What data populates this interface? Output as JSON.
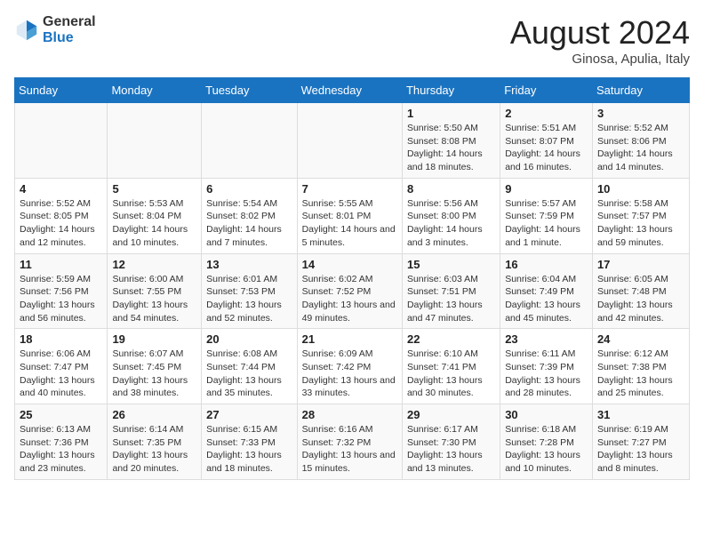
{
  "header": {
    "logo_general": "General",
    "logo_blue": "Blue",
    "main_title": "August 2024",
    "subtitle": "Ginosa, Apulia, Italy"
  },
  "weekdays": [
    "Sunday",
    "Monday",
    "Tuesday",
    "Wednesday",
    "Thursday",
    "Friday",
    "Saturday"
  ],
  "weeks": [
    [
      {
        "day": "",
        "info": ""
      },
      {
        "day": "",
        "info": ""
      },
      {
        "day": "",
        "info": ""
      },
      {
        "day": "",
        "info": ""
      },
      {
        "day": "1",
        "info": "Sunrise: 5:50 AM\nSunset: 8:08 PM\nDaylight: 14 hours and 18 minutes."
      },
      {
        "day": "2",
        "info": "Sunrise: 5:51 AM\nSunset: 8:07 PM\nDaylight: 14 hours and 16 minutes."
      },
      {
        "day": "3",
        "info": "Sunrise: 5:52 AM\nSunset: 8:06 PM\nDaylight: 14 hours and 14 minutes."
      }
    ],
    [
      {
        "day": "4",
        "info": "Sunrise: 5:52 AM\nSunset: 8:05 PM\nDaylight: 14 hours and 12 minutes."
      },
      {
        "day": "5",
        "info": "Sunrise: 5:53 AM\nSunset: 8:04 PM\nDaylight: 14 hours and 10 minutes."
      },
      {
        "day": "6",
        "info": "Sunrise: 5:54 AM\nSunset: 8:02 PM\nDaylight: 14 hours and 7 minutes."
      },
      {
        "day": "7",
        "info": "Sunrise: 5:55 AM\nSunset: 8:01 PM\nDaylight: 14 hours and 5 minutes."
      },
      {
        "day": "8",
        "info": "Sunrise: 5:56 AM\nSunset: 8:00 PM\nDaylight: 14 hours and 3 minutes."
      },
      {
        "day": "9",
        "info": "Sunrise: 5:57 AM\nSunset: 7:59 PM\nDaylight: 14 hours and 1 minute."
      },
      {
        "day": "10",
        "info": "Sunrise: 5:58 AM\nSunset: 7:57 PM\nDaylight: 13 hours and 59 minutes."
      }
    ],
    [
      {
        "day": "11",
        "info": "Sunrise: 5:59 AM\nSunset: 7:56 PM\nDaylight: 13 hours and 56 minutes."
      },
      {
        "day": "12",
        "info": "Sunrise: 6:00 AM\nSunset: 7:55 PM\nDaylight: 13 hours and 54 minutes."
      },
      {
        "day": "13",
        "info": "Sunrise: 6:01 AM\nSunset: 7:53 PM\nDaylight: 13 hours and 52 minutes."
      },
      {
        "day": "14",
        "info": "Sunrise: 6:02 AM\nSunset: 7:52 PM\nDaylight: 13 hours and 49 minutes."
      },
      {
        "day": "15",
        "info": "Sunrise: 6:03 AM\nSunset: 7:51 PM\nDaylight: 13 hours and 47 minutes."
      },
      {
        "day": "16",
        "info": "Sunrise: 6:04 AM\nSunset: 7:49 PM\nDaylight: 13 hours and 45 minutes."
      },
      {
        "day": "17",
        "info": "Sunrise: 6:05 AM\nSunset: 7:48 PM\nDaylight: 13 hours and 42 minutes."
      }
    ],
    [
      {
        "day": "18",
        "info": "Sunrise: 6:06 AM\nSunset: 7:47 PM\nDaylight: 13 hours and 40 minutes."
      },
      {
        "day": "19",
        "info": "Sunrise: 6:07 AM\nSunset: 7:45 PM\nDaylight: 13 hours and 38 minutes."
      },
      {
        "day": "20",
        "info": "Sunrise: 6:08 AM\nSunset: 7:44 PM\nDaylight: 13 hours and 35 minutes."
      },
      {
        "day": "21",
        "info": "Sunrise: 6:09 AM\nSunset: 7:42 PM\nDaylight: 13 hours and 33 minutes."
      },
      {
        "day": "22",
        "info": "Sunrise: 6:10 AM\nSunset: 7:41 PM\nDaylight: 13 hours and 30 minutes."
      },
      {
        "day": "23",
        "info": "Sunrise: 6:11 AM\nSunset: 7:39 PM\nDaylight: 13 hours and 28 minutes."
      },
      {
        "day": "24",
        "info": "Sunrise: 6:12 AM\nSunset: 7:38 PM\nDaylight: 13 hours and 25 minutes."
      }
    ],
    [
      {
        "day": "25",
        "info": "Sunrise: 6:13 AM\nSunset: 7:36 PM\nDaylight: 13 hours and 23 minutes."
      },
      {
        "day": "26",
        "info": "Sunrise: 6:14 AM\nSunset: 7:35 PM\nDaylight: 13 hours and 20 minutes."
      },
      {
        "day": "27",
        "info": "Sunrise: 6:15 AM\nSunset: 7:33 PM\nDaylight: 13 hours and 18 minutes."
      },
      {
        "day": "28",
        "info": "Sunrise: 6:16 AM\nSunset: 7:32 PM\nDaylight: 13 hours and 15 minutes."
      },
      {
        "day": "29",
        "info": "Sunrise: 6:17 AM\nSunset: 7:30 PM\nDaylight: 13 hours and 13 minutes."
      },
      {
        "day": "30",
        "info": "Sunrise: 6:18 AM\nSunset: 7:28 PM\nDaylight: 13 hours and 10 minutes."
      },
      {
        "day": "31",
        "info": "Sunrise: 6:19 AM\nSunset: 7:27 PM\nDaylight: 13 hours and 8 minutes."
      }
    ]
  ]
}
